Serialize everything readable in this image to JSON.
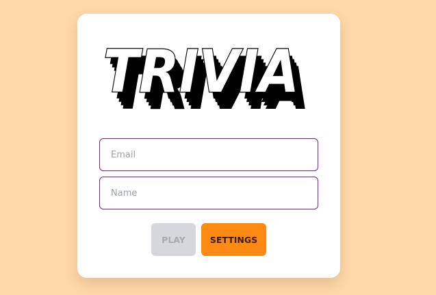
{
  "logo": {
    "text": "TRIVIA"
  },
  "form": {
    "email_placeholder": "Email",
    "email_value": "",
    "name_placeholder": "Name",
    "name_value": ""
  },
  "buttons": {
    "play_label": "PLAY",
    "settings_label": "SETTINGS"
  },
  "colors": {
    "background": "#fed8a9",
    "card": "#ffffff",
    "input_border": "#7a1c92",
    "play_disabled_bg": "#d6d7dc",
    "settings_bg": "#fd8a12"
  }
}
